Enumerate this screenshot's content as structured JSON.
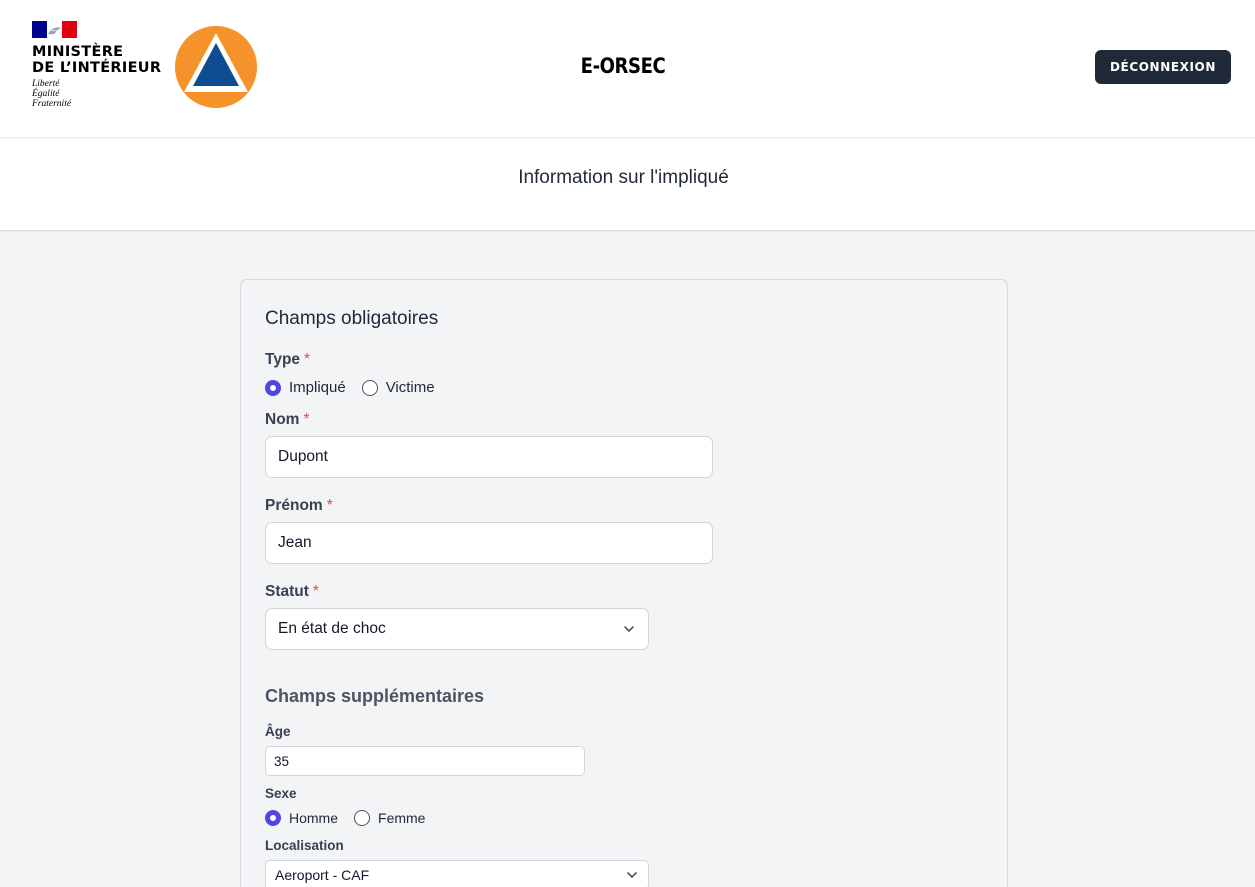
{
  "header": {
    "ministry_lines": [
      "MINISTÈRE",
      "DE L’INTÉRIEUR"
    ],
    "devise_lines": [
      "Liberté",
      "Égalité",
      "Fraternité"
    ],
    "app_title": "E-ORSEC",
    "logout_label": "DÉCONNEXION",
    "colors": {
      "flag_blue": "#000091",
      "flag_red": "#e1000f",
      "civil_orange": "#f5922a",
      "civil_blue": "#0e4d91",
      "button_bg": "#1f2937"
    }
  },
  "page": {
    "title": "Information sur l'impliqué"
  },
  "form": {
    "required_section": {
      "title": "Champs obligatoires",
      "type": {
        "label": "Type",
        "required_mark": "*",
        "options": [
          "Impliqué",
          "Victime"
        ],
        "selected": "Impliqué"
      },
      "nom": {
        "label": "Nom",
        "required_mark": "*",
        "value": "Dupont"
      },
      "prenom": {
        "label": "Prénom",
        "required_mark": "*",
        "value": "Jean"
      },
      "statut": {
        "label": "Statut",
        "required_mark": "*",
        "value": "En état de choc"
      }
    },
    "extra_section": {
      "title": "Champs supplémentaires",
      "age": {
        "label": "Âge",
        "value": "35"
      },
      "sexe": {
        "label": "Sexe",
        "options": [
          "Homme",
          "Femme"
        ],
        "selected": "Homme"
      },
      "localisation": {
        "label": "Localisation",
        "value": "Aeroport - CAF"
      }
    },
    "accent_color": "#4f46e5"
  }
}
